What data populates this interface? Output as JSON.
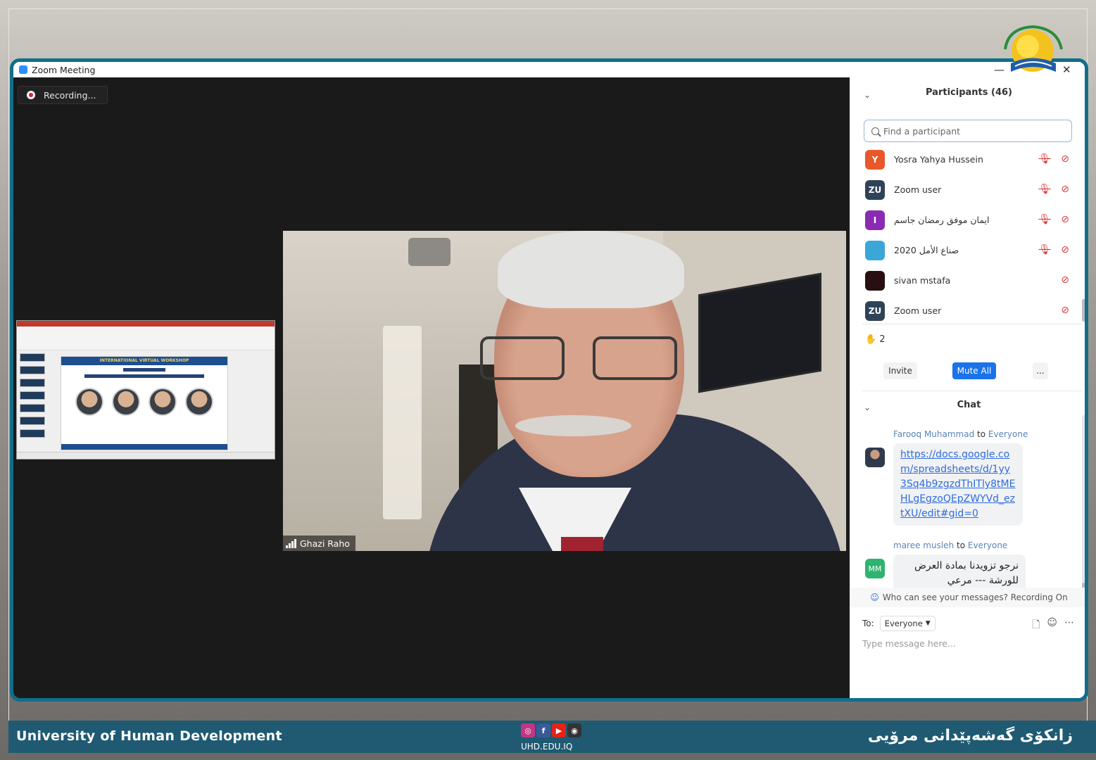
{
  "window": {
    "title": "Zoom Meeting",
    "minimize": "—",
    "close": "✕"
  },
  "recording": {
    "label": "Recording..."
  },
  "speaker": {
    "name": "Ghazi Raho"
  },
  "shared_slide": {
    "banner": "INTERNATIONAL VIRTUAL WORKSHOP"
  },
  "participants": {
    "header": "Participants (46)",
    "search_placeholder": "Find a participant",
    "list": [
      {
        "initials": "Y",
        "name": "Yosra Yahya Hussein",
        "color": "#e9572b",
        "muted": true
      },
      {
        "initials": "ZU",
        "name": "Zoom user",
        "color": "#2f4358",
        "muted": true
      },
      {
        "initials": "I",
        "name": "ايمان موفق رمضان جاسم",
        "color": "#8a2bb3",
        "muted": true
      },
      {
        "initials": "",
        "name": "صناع الأمل 2020",
        "color": "#3aa7d8",
        "muted": true
      },
      {
        "initials": "",
        "name": "sivan mstafa",
        "color": "#2a0f12",
        "muted": false
      },
      {
        "initials": "ZU",
        "name": "Zoom user",
        "color": "#2f4358",
        "muted": false
      }
    ],
    "raised_hands": "✋ 2",
    "invite_label": "Invite",
    "mute_all_label": "Mute All",
    "more_label": "..."
  },
  "chat": {
    "header": "Chat",
    "messages": [
      {
        "sender": "Farooq Muhammad",
        "to_word": "to",
        "recipient": "Everyone",
        "text": "https://docs.google.com/spreadsheets/d/1yy3Sq4b9zgzdThITly8tMEHLgEgzoQEpZWYVd_eztXU/edit#gid=0"
      },
      {
        "sender": "maree musleh",
        "to_word": "to",
        "recipient": "Everyone",
        "initials": "MM",
        "text": "نرجو تزويدنا بمادة العرض للورشة --- مرعي"
      }
    ],
    "visibility_note": "Who can see your messages? Recording On",
    "to_label": "To:",
    "to_value": "Everyone",
    "input_placeholder": "Type message here..."
  },
  "footer": {
    "university_en": "University of Human Development",
    "university_ku": "زانكۆی گەشەپێدانی مرۆیی",
    "website": "UHD.EDU.IQ",
    "social_icons": [
      "instagram-icon",
      "facebook-icon",
      "youtube-icon",
      "web-icon"
    ]
  },
  "colors": {
    "frame": "#0f6e8c",
    "footer": "#1f5a72",
    "mute_all": "#1a73e8"
  }
}
